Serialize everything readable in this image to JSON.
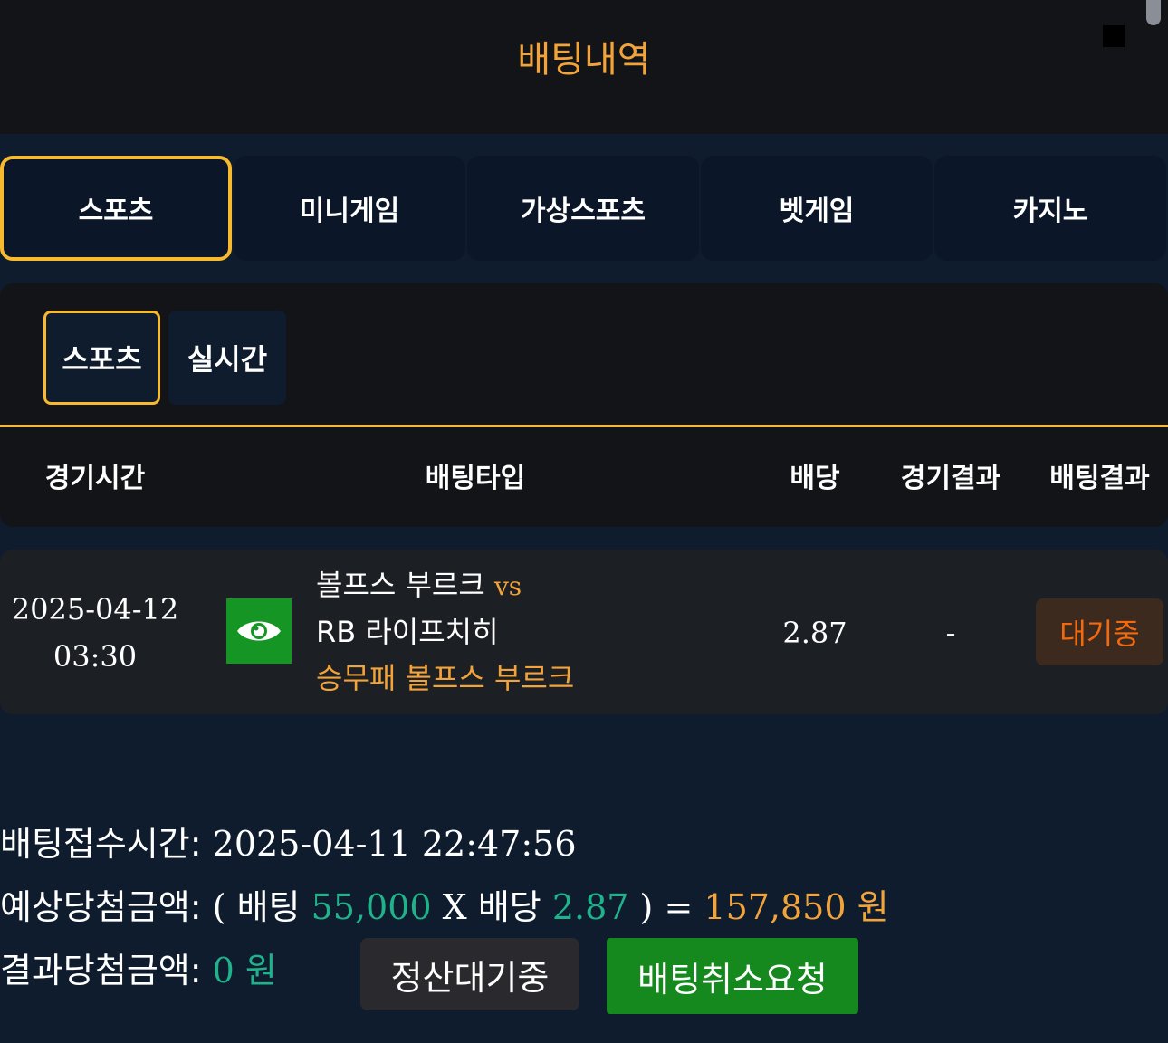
{
  "header": {
    "title": "배팅내역"
  },
  "main_tabs": [
    {
      "label": "스포츠",
      "active": true
    },
    {
      "label": "미니게임",
      "active": false
    },
    {
      "label": "가상스포츠",
      "active": false
    },
    {
      "label": "벳게임",
      "active": false
    },
    {
      "label": "카지노",
      "active": false
    }
  ],
  "sub_tabs": [
    {
      "label": "스포츠",
      "active": true
    },
    {
      "label": "실시간",
      "active": false
    }
  ],
  "table": {
    "headers": [
      "경기시간",
      "배팅타입",
      "배당",
      "경기결과",
      "배팅결과"
    ],
    "rows": [
      {
        "date": "2025-04-12",
        "time": "03:30",
        "home_team": "볼프스 부르크",
        "vs": "vs",
        "away_team": "RB 라이프치히",
        "pick": "승무패 볼프스 부르크",
        "odds": "2.87",
        "game_result": "-",
        "bet_result": "대기중"
      }
    ]
  },
  "summary": {
    "received_label": "배팅접수시간:",
    "received_value": "2025-04-11 22:47:56",
    "expected_label": "예상당첨금액:",
    "open_paren": "(",
    "bet_word": "배팅",
    "bet_amount": "55,000",
    "times": "X",
    "odds_word": "배당",
    "odds_value": "2.87",
    "close_eq": ") =",
    "expected_amount": "157,850 원",
    "result_label": "결과당첨금액:",
    "result_amount": "0 원"
  },
  "buttons": {
    "settle_status": "정산대기중",
    "cancel_request": "배팅취소요청"
  },
  "colors": {
    "accent": "#f7b92d",
    "title_orange": "#f2a33a",
    "value_green": "#20b28a",
    "pending_orange": "#f36a0e",
    "button_green": "#15891e"
  }
}
